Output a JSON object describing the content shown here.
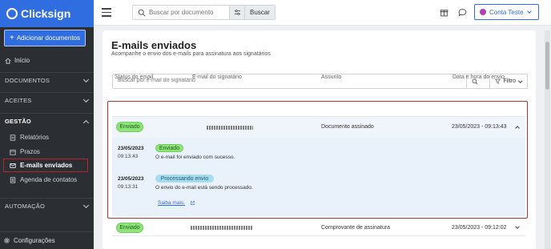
{
  "brand": {
    "name": "Clicksign"
  },
  "sidebar": {
    "add_button": "Adicionar documentos",
    "home": "Início",
    "sections": {
      "documentos": "DOCUMENTOS",
      "aceites": "ACEITES",
      "gestao": "GESTÃO",
      "automacao": "AUTOMAÇÃO"
    },
    "gestao_items": [
      "Relatórios",
      "Prazos",
      "E-mails enviados",
      "Agenda de contatos"
    ],
    "config": "Configurações"
  },
  "topbar": {
    "search_placeholder": "Buscar por documento",
    "search_button": "Buscar",
    "account": "Conta Teste"
  },
  "page": {
    "title": "E-mails enviados",
    "subtitle": "Acompanhe o envio dos e-mails para assinatura aos signatários",
    "filter_placeholder": "Buscar por e-mail do signatário",
    "filter_button": "Filtro"
  },
  "table": {
    "headers": [
      "Status do email",
      "E-mail do signatário",
      "Assunto",
      "Data e hora do envio"
    ],
    "rows": [
      {
        "status": "Enviado",
        "subject": "Documento assinado",
        "datetime": "23/05/2023 - 09:13:43"
      },
      {
        "status": "Enviado",
        "subject": "Comprovante de assinatura",
        "datetime": "23/05/2023 - 09:12:02"
      }
    ],
    "events": [
      {
        "date": "23/05/2023",
        "time": "09:13:43",
        "badge": "Enviado",
        "text": "O e-mail foi enviado com sucesso."
      },
      {
        "date": "23/05/2023",
        "time": "09:13:31",
        "badge": "Processando envio",
        "text": "O envio do e-mail está sendo processado."
      }
    ],
    "more_link": "Saiba mais."
  },
  "colors": {
    "brand_blue": "#2f6de0",
    "sidebar": "#2b2f33",
    "highlight": "#a33a2c",
    "sent": "#8ee37a",
    "processing": "#a7dcef"
  }
}
